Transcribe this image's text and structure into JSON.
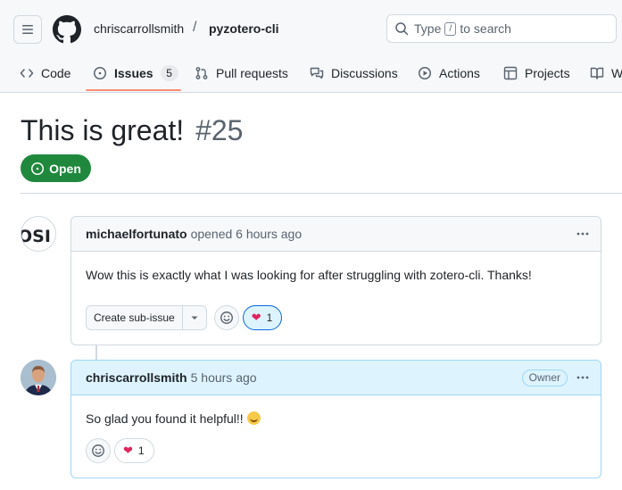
{
  "header": {
    "owner": "chriscarrollsmith",
    "separator": "/",
    "repo": "pyzotero-cli",
    "search_placeholder_before": "Type",
    "search_key": "/",
    "search_placeholder_after": "to search"
  },
  "tabs": [
    {
      "label": "Code",
      "icon": "code-icon"
    },
    {
      "label": "Issues",
      "icon": "issue-opened-icon",
      "count": "5",
      "active": true
    },
    {
      "label": "Pull requests",
      "icon": "git-pull-request-icon"
    },
    {
      "label": "Discussions",
      "icon": "comment-discussion-icon"
    },
    {
      "label": "Actions",
      "icon": "play-icon"
    },
    {
      "label": "Projects",
      "icon": "table-icon"
    },
    {
      "label": "W",
      "icon": "book-icon"
    }
  ],
  "issue": {
    "title": "This is great!",
    "number": "#25",
    "state": "Open"
  },
  "comments": [
    {
      "author": "michaelfortunato",
      "meta": "opened 6 hours ago",
      "avatar_text": "OSI",
      "body": "Wow this is exactly what I was looking for after struggling with zotero-cli. Thanks!",
      "sub_issue_label": "Create sub-issue",
      "reaction_count": "1"
    },
    {
      "author": "chriscarrollsmith",
      "meta": "5 hours ago",
      "badge": "Owner",
      "body": "So glad you found it helpful!!",
      "reaction_count": "1"
    }
  ],
  "colors": {
    "open_green": "#1f883d",
    "tab_underline": "#fd8c73",
    "owner_header_bg": "#ddf4ff",
    "heart": "#e0245e"
  }
}
